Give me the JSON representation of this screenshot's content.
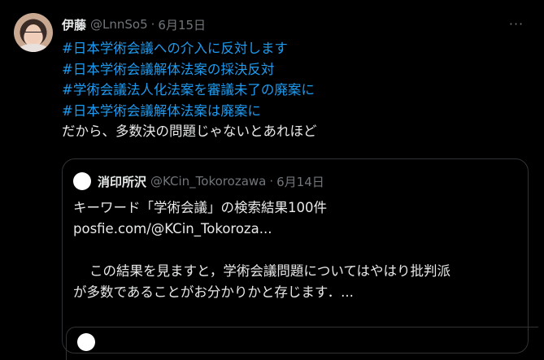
{
  "tweet": {
    "display_name": "伊藤",
    "handle": "@LnnSo5",
    "separator": "·",
    "date": "6月15日",
    "more_label": "···",
    "lines": [
      {
        "text": "#日本学術会議への介入に反対します",
        "type": "hashtag"
      },
      {
        "text": "#日本学術会議解体法案の採決反対",
        "type": "hashtag"
      },
      {
        "text": "#学術会議法人化法案を審議未了の廃案に",
        "type": "hashtag"
      },
      {
        "text": "#日本学術会議解体法案は廃案に",
        "type": "hashtag"
      },
      {
        "text": "だから、多数決の問題じゃないとあれほど",
        "type": "plain"
      }
    ]
  },
  "quote": {
    "display_name": "消印所沢",
    "handle": "@KCin_Tokorozawa",
    "separator": "·",
    "date": "6月14日",
    "lines": [
      "キーワード「学術会議」の検索結果100件",
      "posfie.com/@KCin_Tokoroza...",
      "",
      "この結果を見ますと，学術会議問題についてはやはり批判派",
      "が多数であることがお分かりかと存じます．..."
    ]
  },
  "colors": {
    "background": "#000000",
    "text": "#e7e9ea",
    "secondary": "#71767b",
    "link": "#1d9bf0",
    "border": "#2f3336"
  }
}
